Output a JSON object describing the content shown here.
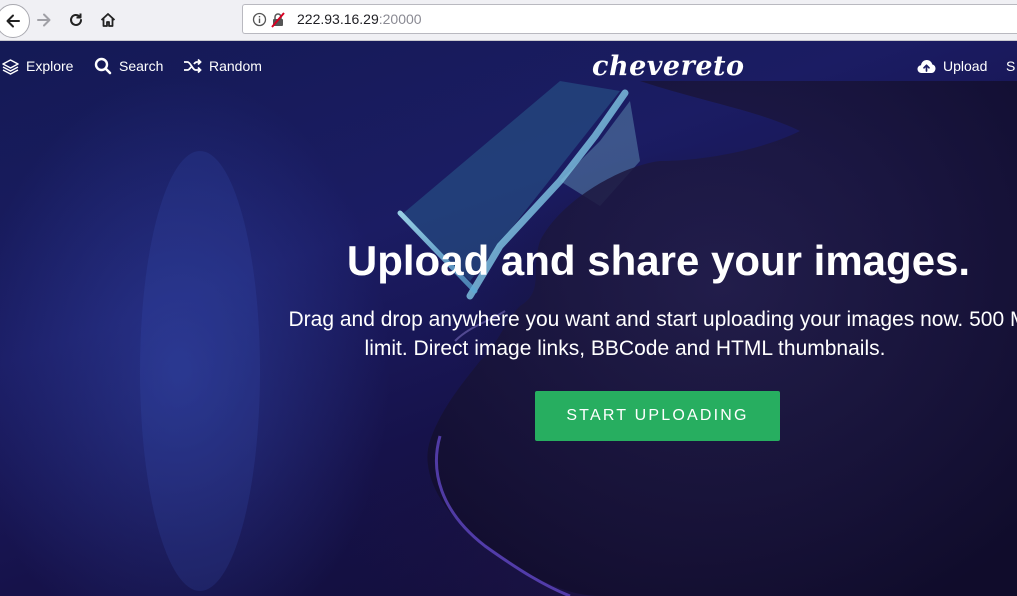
{
  "browser": {
    "url_host": "222.93.16.29",
    "url_port": ":20000"
  },
  "nav": {
    "explore": "Explore",
    "search": "Search",
    "random": "Random",
    "upload": "Upload",
    "partial": "S"
  },
  "logo": "chevereto",
  "hero": {
    "title": "Upload and share your images.",
    "desc_line1": "Drag and drop anywhere you want and start uploading your images now. 500 M",
    "desc_line2": "limit. Direct image links, BBCode and HTML thumbnails.",
    "button": "START UPLOADING"
  },
  "colors": {
    "button": "#27ae60",
    "screen_glow": "#9fd8ea",
    "background": "#1b1c63"
  },
  "icons": [
    "back-arrow-icon",
    "forward-arrow-icon",
    "reload-icon",
    "home-icon",
    "info-icon",
    "insecure-lock-icon",
    "layers-icon",
    "search-icon",
    "shuffle-icon",
    "cloud-upload-icon"
  ]
}
